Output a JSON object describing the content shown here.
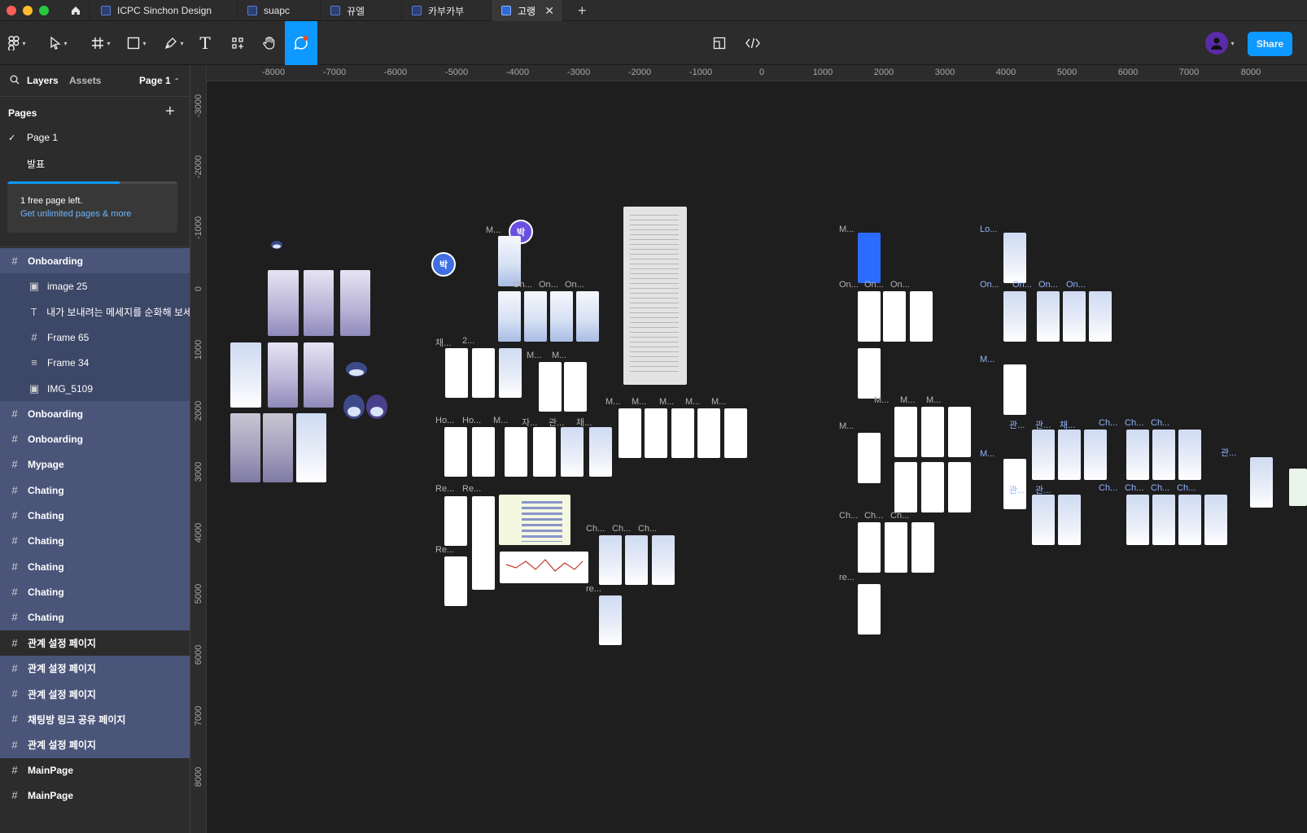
{
  "tabs": [
    {
      "label": "ICPC Sinchon Design"
    },
    {
      "label": "suapc"
    },
    {
      "label": "뀨엘"
    },
    {
      "label": "카부카부"
    },
    {
      "label": "고랭"
    }
  ],
  "toolbar": {
    "share_label": "Share"
  },
  "sidebar": {
    "tab_layers": "Layers",
    "tab_assets": "Assets",
    "page_selector": "Page 1",
    "pages_heading": "Pages",
    "pages": [
      {
        "label": "Page 1",
        "selected": true
      },
      {
        "label": "발표",
        "selected": false
      }
    ],
    "banner": {
      "text": "1 free page left.",
      "link": "Get unlimited pages & more",
      "progress": 0.66
    },
    "layers": [
      {
        "label": "Onboarding",
        "icon": "frame-icon",
        "child": false,
        "selected": true
      },
      {
        "label": "image 25",
        "icon": "image-icon",
        "child": true,
        "selected": true
      },
      {
        "label": "내가 보내려는 메세지를 순화해 보세...",
        "icon": "text-icon",
        "child": true,
        "selected": true
      },
      {
        "label": "Frame 65",
        "icon": "frame-icon",
        "child": true,
        "selected": true
      },
      {
        "label": "Frame 34",
        "icon": "autolayout-icon",
        "child": true,
        "selected": true
      },
      {
        "label": "IMG_5109",
        "icon": "image-icon",
        "child": true,
        "selected": true
      },
      {
        "label": "Onboarding",
        "icon": "frame-icon",
        "child": false,
        "selected": true
      },
      {
        "label": "Onboarding",
        "icon": "frame-icon",
        "child": false,
        "selected": true
      },
      {
        "label": "Mypage",
        "icon": "frame-icon",
        "child": false,
        "selected": true
      },
      {
        "label": "Chating",
        "icon": "frame-icon",
        "child": false,
        "selected": true
      },
      {
        "label": "Chating",
        "icon": "frame-icon",
        "child": false,
        "selected": true
      },
      {
        "label": "Chating",
        "icon": "frame-icon",
        "child": false,
        "selected": true
      },
      {
        "label": "Chating",
        "icon": "frame-icon",
        "child": false,
        "selected": true
      },
      {
        "label": "Chating",
        "icon": "frame-icon",
        "child": false,
        "selected": true
      },
      {
        "label": "Chating",
        "icon": "frame-icon",
        "child": false,
        "selected": true
      },
      {
        "label": "관계 설정 페이지",
        "icon": "frame-icon",
        "child": false,
        "selected": false
      },
      {
        "label": "관계 설정 페이지",
        "icon": "frame-icon",
        "child": false,
        "selected": true
      },
      {
        "label": "관계 설정 페이지",
        "icon": "frame-icon",
        "child": false,
        "selected": true
      },
      {
        "label": "채팅방 링크 공유 페이지",
        "icon": "frame-icon",
        "child": false,
        "selected": true
      },
      {
        "label": "관계 설정 페이지",
        "icon": "frame-icon",
        "child": false,
        "selected": true
      },
      {
        "label": "MainPage",
        "icon": "frame-icon",
        "child": false,
        "selected": false
      },
      {
        "label": "MainPage",
        "icon": "frame-icon",
        "child": false,
        "selected": false
      }
    ]
  },
  "rulers": {
    "top": [
      "-8000",
      "-7000",
      "-6000",
      "-5000",
      "-4000",
      "-3000",
      "-2000",
      "-1000",
      "0",
      "1000",
      "2000",
      "3000",
      "4000",
      "5000",
      "6000",
      "7000",
      "8000"
    ],
    "left": [
      "-3000",
      "-2000",
      "-1000",
      "0",
      "1000",
      "2000",
      "3000",
      "4000",
      "5000",
      "6000",
      "7000",
      "8000"
    ]
  },
  "canvas": {
    "cursor_name": "박",
    "frame_labels": [
      "M...",
      "On...",
      "On...",
      "On...",
      "채...",
      "2...",
      "M...",
      "M...",
      "Ho...",
      "Ho...",
      "M...",
      "자...",
      "관...",
      "채...",
      "Re...",
      "Re...",
      "Re...",
      "M...",
      "M...",
      "M...",
      "M...",
      "M...",
      "Ch...",
      "Ch...",
      "Ch...",
      "re...",
      "M...",
      "On...",
      "On...",
      "On...",
      "M...",
      "M...",
      "M...",
      "M...",
      "Ch...",
      "Ch...",
      "Ch...",
      "re...",
      "Lo...",
      "On...",
      "On...",
      "On...",
      "On...",
      "M...",
      "M...",
      "관...",
      "관...",
      "채...",
      "관...",
      "관...",
      "Ch...",
      "Ch...",
      "Ch...",
      "Ch...",
      "Ch...",
      "Ch...",
      "Ch...",
      "관..."
    ]
  },
  "colors": {
    "accent": "#0d99ff",
    "selection": "#4a5579",
    "canvas": "#1e1e1e",
    "panel": "#2c2c2c"
  }
}
